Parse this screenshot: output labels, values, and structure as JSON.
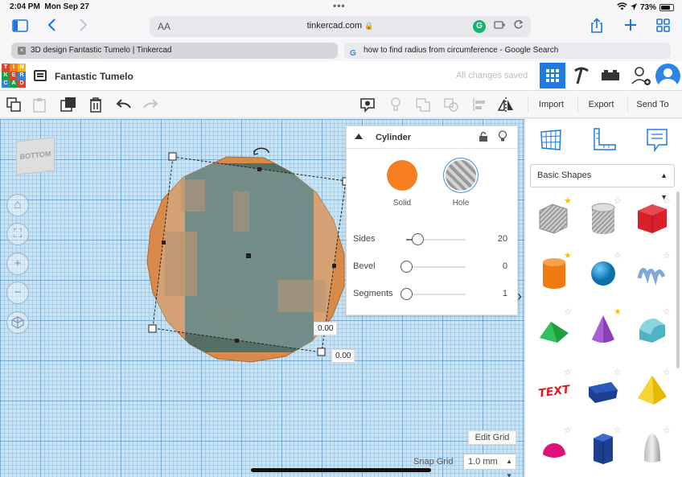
{
  "status_bar": {
    "time": "2:04 PM",
    "date": "Mon Sep 27",
    "battery": "73%"
  },
  "browser": {
    "aa_label": "AA",
    "url": "tinkercad.com",
    "tabs": [
      {
        "title": "3D design Fantastic Tumelo | Tinkercad",
        "active": true
      },
      {
        "title": "how to find radius from circumference - Google Search",
        "active": false
      }
    ]
  },
  "app": {
    "logo_letters": [
      "T",
      "I",
      "N",
      "K",
      "E",
      "R",
      "C",
      "A",
      "D"
    ],
    "logo_colors": [
      "#e2412f",
      "#f57e20",
      "#f9b81b",
      "#1f9f3f",
      "#e2412f",
      "#2b85e4",
      "#2b85e4",
      "#1f9f3f",
      "#e2412f"
    ],
    "design_name": "Fantastic Tumelo",
    "save_status": "All changes saved"
  },
  "edit_toolbar": {
    "import_label": "Import",
    "export_label": "Export",
    "send_to_label": "Send To"
  },
  "workplane": {
    "view_cube_label": "BOTTOM",
    "dim_value_1": "0.00",
    "dim_value_2": "0.00",
    "edit_grid_label": "Edit Grid",
    "snap_grid_label": "Snap Grid",
    "snap_grid_value": "1.0 mm"
  },
  "inspector": {
    "title": "Cylinder",
    "solid_label": "Solid",
    "hole_label": "Hole",
    "solid_color": "#f57e20",
    "properties": [
      {
        "name": "Sides",
        "value": "20",
        "fraction": 0.19
      },
      {
        "name": "Bevel",
        "value": "0",
        "fraction": 0.0
      },
      {
        "name": "Segments",
        "value": "1",
        "fraction": 0.0
      }
    ]
  },
  "shapes_panel": {
    "category": "Basic Shapes",
    "shapes": [
      {
        "name": "box-hole",
        "favorite": true
      },
      {
        "name": "cylinder-hole",
        "favorite": false
      },
      {
        "name": "box",
        "favorite": false
      },
      {
        "name": "cylinder",
        "favorite": true
      },
      {
        "name": "sphere",
        "favorite": false
      },
      {
        "name": "scribble",
        "favorite": false
      },
      {
        "name": "roof",
        "favorite": false
      },
      {
        "name": "cone",
        "favorite": true
      },
      {
        "name": "round-roof",
        "favorite": false
      },
      {
        "name": "text",
        "favorite": false
      },
      {
        "name": "wedge",
        "favorite": false
      },
      {
        "name": "pyramid",
        "favorite": false
      },
      {
        "name": "half-sphere",
        "favorite": false
      },
      {
        "name": "polygon",
        "favorite": false
      },
      {
        "name": "paraboloid",
        "favorite": false
      }
    ]
  }
}
